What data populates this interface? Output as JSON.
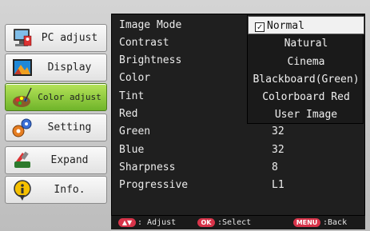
{
  "sidebar": {
    "items": [
      {
        "label": "PC adjust",
        "icon": "pc-adjust-icon"
      },
      {
        "label": "Display",
        "icon": "display-icon"
      },
      {
        "label": "Color adjust",
        "icon": "color-adjust-icon"
      },
      {
        "label": "Setting",
        "icon": "setting-icon"
      },
      {
        "label": "Expand",
        "icon": "expand-icon"
      },
      {
        "label": "Info.",
        "icon": "info-icon"
      }
    ],
    "active_index": 2,
    "active_color": "#8cc63f"
  },
  "menu": {
    "rows": [
      {
        "label": "Image Mode",
        "value": ""
      },
      {
        "label": "Contrast",
        "value": ""
      },
      {
        "label": "Brightness",
        "value": ""
      },
      {
        "label": "Color",
        "value": ""
      },
      {
        "label": "Tint",
        "value": ""
      },
      {
        "label": "Red",
        "value": ""
      },
      {
        "label": "Green",
        "value": "32"
      },
      {
        "label": "Blue",
        "value": "32"
      },
      {
        "label": "Sharpness",
        "value": "8"
      },
      {
        "label": "Progressive",
        "value": "L1"
      }
    ]
  },
  "image_mode_dropdown": {
    "selected": "Normal",
    "options": [
      "Normal",
      "Natural",
      "Cinema",
      "Blackboard(Green)",
      "Colorboard Red",
      "User Image"
    ]
  },
  "footer": {
    "adjust_key": "▲▼",
    "adjust_label": ": Adjust",
    "select_key": "OK",
    "select_label": ":Select",
    "back_key": "MENU",
    "back_label": ":Back",
    "key_color": "#d8344a"
  }
}
